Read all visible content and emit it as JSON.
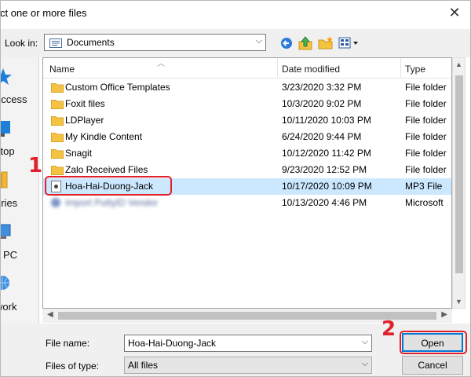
{
  "window": {
    "title": "ct one or more files",
    "close_glyph": "✕"
  },
  "lookin": {
    "label": "Look in:",
    "value": "Documents"
  },
  "toolbar": {
    "icons": [
      "back-icon",
      "up-folder-icon",
      "new-folder-icon",
      "view-menu-icon"
    ]
  },
  "places": [
    {
      "label": "access",
      "icon": "star-icon"
    },
    {
      "label": "ctop",
      "icon": "desktop-icon"
    },
    {
      "label": "aries",
      "icon": "library-icon"
    },
    {
      "label": "PC",
      "icon": "computer-icon"
    },
    {
      "label": "work",
      "icon": "network-icon"
    }
  ],
  "columns": {
    "name": "Name",
    "date": "Date modified",
    "type": "Type"
  },
  "files": [
    {
      "name": "Custom Office Templates",
      "date": "3/23/2020 3:32 PM",
      "type": "File folder",
      "icon": "folder-icon"
    },
    {
      "name": "Foxit files",
      "date": "10/3/2020 9:02 PM",
      "type": "File folder",
      "icon": "folder-icon"
    },
    {
      "name": "LDPlayer",
      "date": "10/11/2020 10:03 PM",
      "type": "File folder",
      "icon": "folder-icon"
    },
    {
      "name": "My Kindle Content",
      "date": "6/24/2020 9:44 PM",
      "type": "File folder",
      "icon": "folder-icon"
    },
    {
      "name": "Snagit",
      "date": "10/12/2020 11:42 PM",
      "type": "File folder",
      "icon": "folder-icon"
    },
    {
      "name": "Zalo Received Files",
      "date": "9/23/2020 12:52 PM",
      "type": "File folder",
      "icon": "folder-icon"
    },
    {
      "name": "Hoa-Hai-Duong-Jack",
      "date": "10/17/2020 10:09 PM",
      "type": "MP3 File",
      "icon": "mp3-file-icon",
      "selected": true
    },
    {
      "name": "Import PuttyID Vendor",
      "date": "10/13/2020 4:46 PM",
      "type": "Microsoft",
      "icon": "blurred-file-icon",
      "blurred": true
    }
  ],
  "filename": {
    "label": "File name:",
    "value": "Hoa-Hai-Duong-Jack"
  },
  "filetype": {
    "label": "Files of type:",
    "value": "All files"
  },
  "buttons": {
    "open": "Open",
    "cancel": "Cancel"
  },
  "annotations": {
    "step1": "1",
    "step2": "2",
    "color": "#e0202a"
  },
  "colors": {
    "selection": "#cce8ff",
    "folder": "#f5c342",
    "accent": "#0078d7"
  }
}
